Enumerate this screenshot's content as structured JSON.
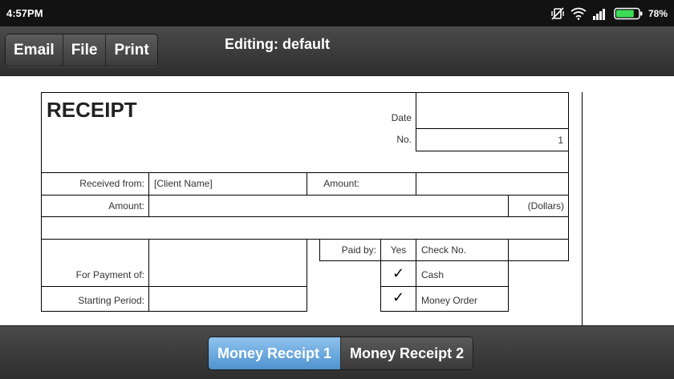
{
  "status_bar": {
    "time": "4:57PM",
    "battery_percent": "78%",
    "battery_level": 0.78,
    "battery_color": "#3ddc57"
  },
  "toolbar": {
    "email_label": "Email",
    "file_label": "File",
    "print_label": "Print",
    "title": "Editing: default"
  },
  "receipt": {
    "heading": "RECEIPT",
    "date_label": "Date",
    "date_value": "",
    "no_label": "No.",
    "no_value": "1",
    "received_from_label": "Received from:",
    "client_name": "[Client Name]",
    "amount_label_1": "Amount:",
    "amount_value_1": "",
    "amount_label_2": "Amount:",
    "amount_words_value": "",
    "dollars_label": "(Dollars)",
    "for_payment_label": "For Payment of:",
    "for_payment_value": "",
    "starting_period_label": "Starting Period:",
    "starting_period_value": "",
    "paid_by_label": "Paid by:",
    "yes_label": "Yes",
    "check_no_label": "Check No.",
    "check_no_value": "",
    "cash_label": "Cash",
    "cash_checked": true,
    "money_order_label": "Money Order",
    "money_order_checked": true,
    "check_mark": "✓"
  },
  "tabs": {
    "tab1_label": "Money Receipt 1",
    "tab2_label": "Money Receipt 2",
    "active": 0,
    "active_color": "#6aaee3"
  }
}
